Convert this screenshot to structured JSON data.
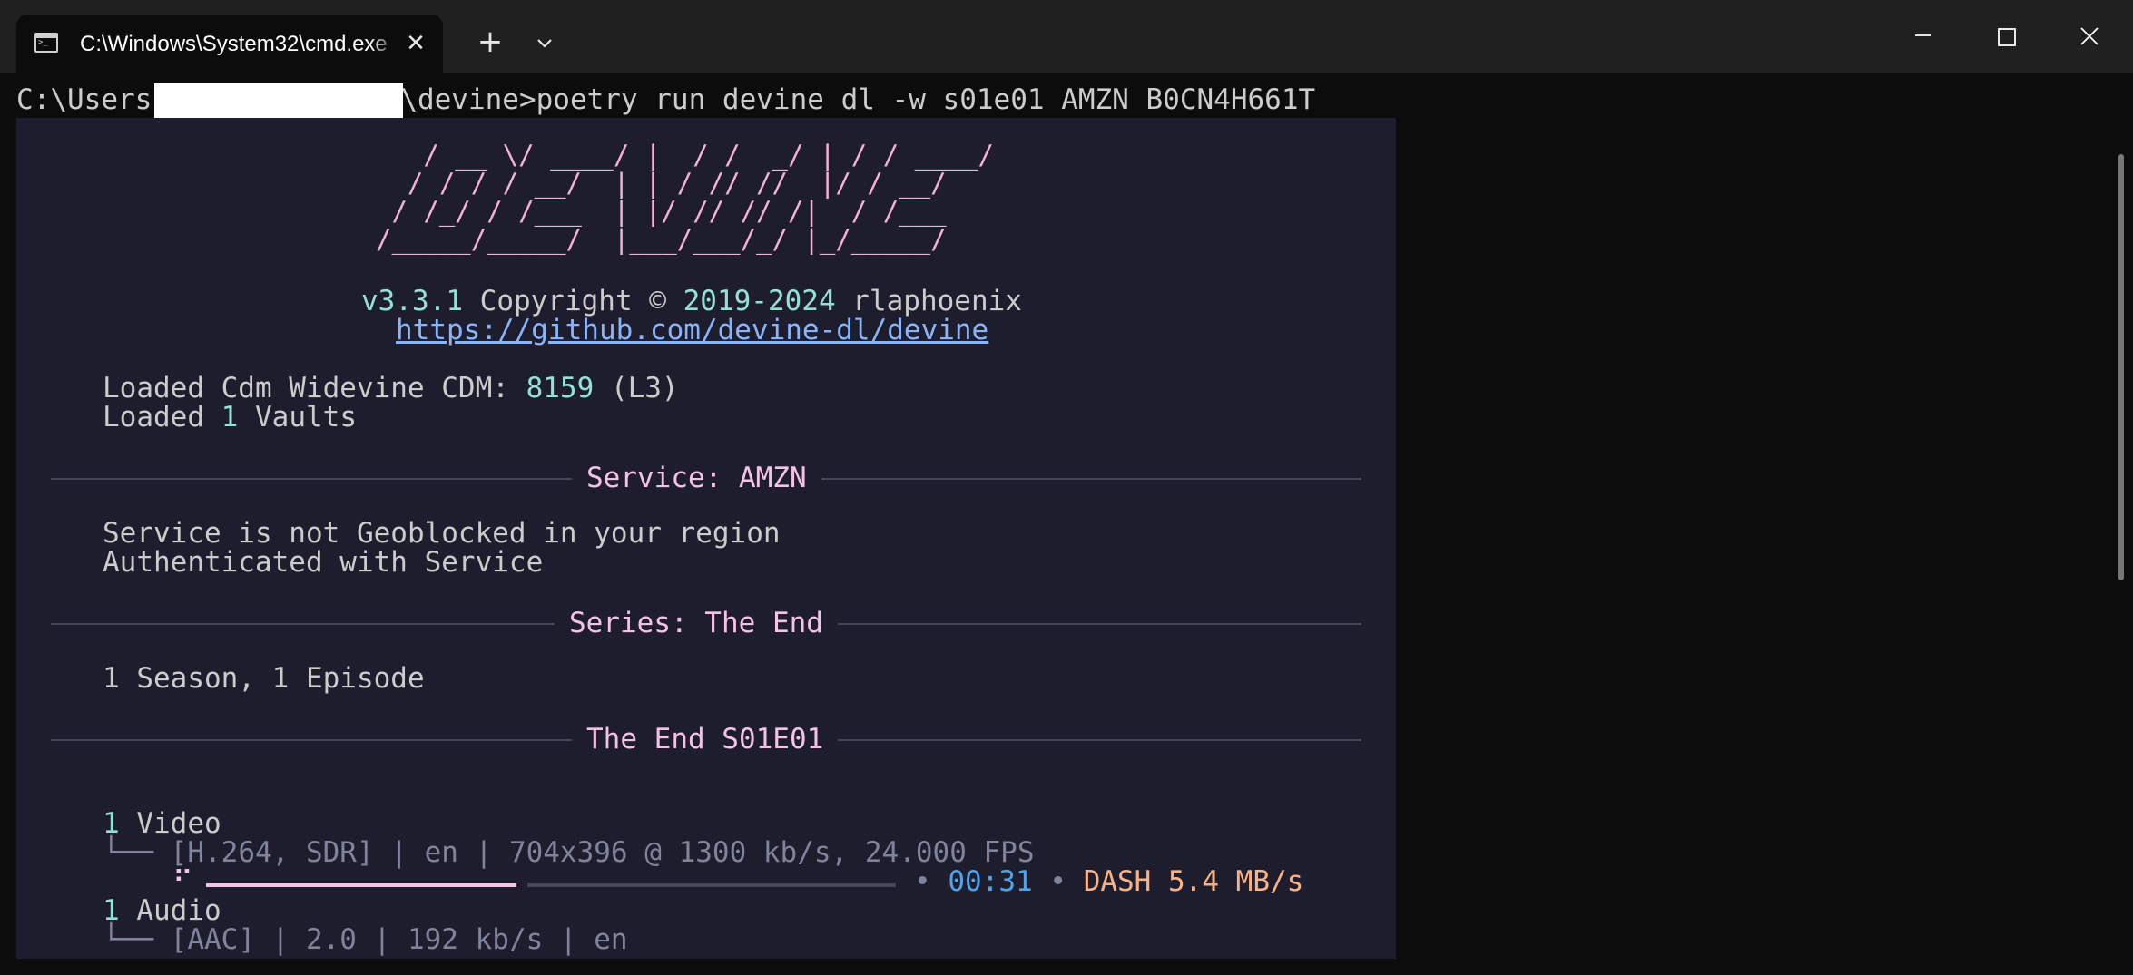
{
  "window": {
    "tab_title": "C:\\Windows\\System32\\cmd.exe",
    "tab_icon": "command-prompt-icon",
    "new_tab_icon": "plus-icon",
    "tab_menu_icon": "chevron-down-icon",
    "minimize_icon": "minimize-icon",
    "maximize_icon": "maximize-icon",
    "close_icon": "close-icon"
  },
  "terminal": {
    "prompt_prefix": "C:\\Users",
    "prompt_suffix": "\\devine>poetry run devine dl -w s01e01 AMZN B0CN4H661T"
  },
  "banner": {
    "logo_lines": [
      "   / __ \\/ ____/ |  / /  _/ | / / ____/",
      "  / / / / __/  | | / // //  |/ / __/",
      " / /_/ / /___  | |/ // // /|  / /___",
      "/_____/_____/  |___/___/_/ |_/_____/"
    ],
    "version": "v3.3.1",
    "copyright_label": "Copyright ©",
    "years": "2019-2024",
    "author": "rlaphoenix",
    "url": "https://github.com/devine-dl/devine"
  },
  "status": {
    "cdm_prefix": "Loaded Cdm Widevine CDM:",
    "cdm_id": "8159",
    "cdm_level": "(L3)",
    "vaults_prefix": "Loaded",
    "vaults_count": "1",
    "vaults_suffix": "Vaults"
  },
  "sections": {
    "service": "Service: AMZN",
    "service_line1": "Service is not Geoblocked in your region",
    "service_line2": "Authenticated with Service",
    "series": "Series: The End",
    "series_summary": "1 Season, 1 Episode",
    "episode": "The End S01E01"
  },
  "tracks": {
    "video_count": "1",
    "video_label": "Video",
    "video_tree": "└──",
    "video_info": "[H.264, SDR] | en | 704x396 @ 1300 kb/s, 24.000 FPS",
    "spinner": "⠋",
    "progress": 0.45,
    "bullet": "•",
    "elapsed": "00:31",
    "protocol": "DASH",
    "speed": "5.4 MB/s",
    "audio_count": "1",
    "audio_label": "Audio",
    "audio_tree": "└──",
    "audio_info": "[AAC] | 2.0 | 192 kb/s | en"
  },
  "colors": {
    "terminal_bg": "#0c0c0c",
    "panel_bg": "#1e1d2e",
    "accent_pink": "#f5c2e7",
    "accent_cyan": "#94e2d5",
    "link_blue": "#89b4fa",
    "time_blue": "#4fa3e8",
    "orange": "#fab387"
  }
}
